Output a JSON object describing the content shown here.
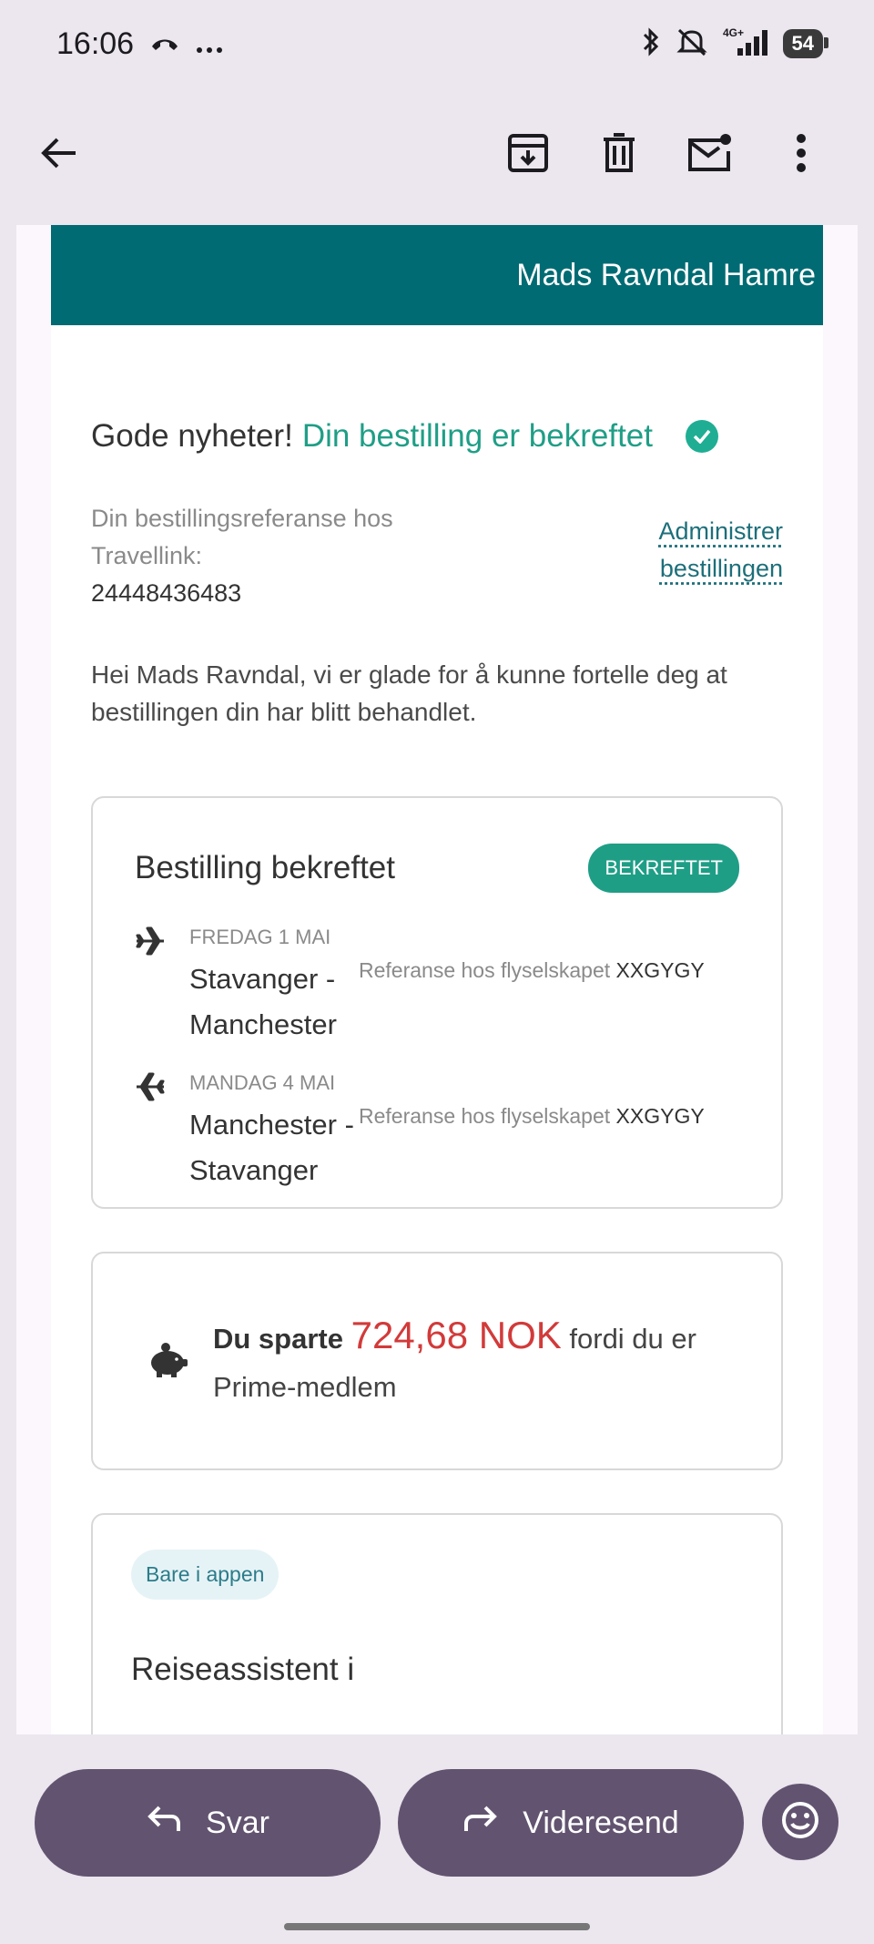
{
  "status_bar": {
    "time": "16:06",
    "battery": "54",
    "network": "4G+"
  },
  "app_bar": {
    "icons": [
      "back-arrow-icon",
      "archive-icon",
      "delete-icon",
      "mark-unread-icon",
      "more-vert-icon"
    ]
  },
  "email": {
    "banner_name": "Mads Ravndal Hamre",
    "headline_prefix": "Gode nyheter!",
    "headline_status": "Din bestilling er bekreftet",
    "reference_label": "Din bestillingsreferanse hos Travellink:",
    "reference_number": "24448436483",
    "manage_link": "Administrer bestillingen",
    "greeting": "Hei Mads Ravndal, vi er glade for å kunne fortelle deg at bestillingen din har blitt behandlet.",
    "booking_card": {
      "title": "Bestilling bekreftet",
      "badge": "BEKREFTET",
      "flights": [
        {
          "date": "FREDAG 1 MAI",
          "route": "Stavanger - Manchester",
          "airline_ref_label": "Referanse hos flyselskapet",
          "airline_ref": "XXGYGY"
        },
        {
          "date": "MANDAG 4 MAI",
          "route": "Manchester - Stavanger",
          "airline_ref_label": "Referanse hos flyselskapet",
          "airline_ref": "XXGYGY"
        }
      ]
    },
    "savings_card": {
      "prefix": "Du sparte",
      "amount": "724,68 NOK",
      "suffix": "fordi du er Prime-medlem"
    },
    "app_card": {
      "pill": "Bare i appen",
      "title": "Reiseassistent i"
    }
  },
  "bottom_bar": {
    "reply_label": "Svar",
    "forward_label": "Videresend"
  },
  "colors": {
    "banner": "#006b73",
    "accent_green": "#1f9e86",
    "savings_red": "#d23a3a",
    "action_button": "#625470"
  }
}
